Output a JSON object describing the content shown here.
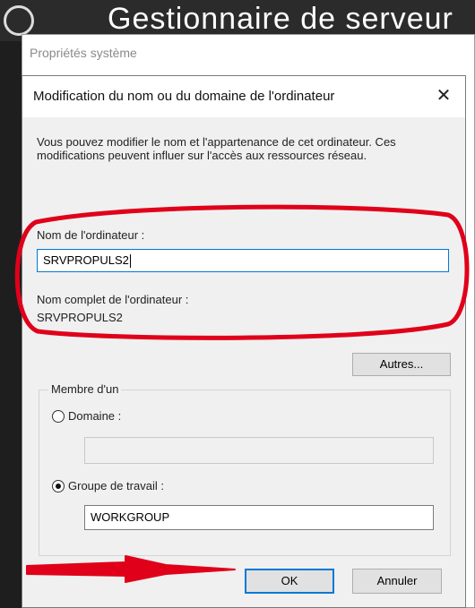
{
  "background_window": {
    "title": "Gestionnaire de serveur"
  },
  "system_properties": {
    "title": "Propriétés système"
  },
  "dialog": {
    "title": "Modification du nom ou du domaine de l'ordinateur",
    "close_symbol": "✕",
    "description": "Vous pouvez modifier le nom et l'appartenance de cet ordinateur. Ces modifications peuvent influer sur l'accès aux ressources réseau.",
    "computer_name_label": "Nom de l'ordinateur :",
    "computer_name_value": "SRVPROPULS2",
    "full_name_label": "Nom complet de l'ordinateur :",
    "full_name_value": "SRVPROPULS2",
    "more_button": "Autres...",
    "member_of": {
      "label": "Membre d'un",
      "domain_label": "Domaine :",
      "domain_value": "",
      "domain_selected": false,
      "workgroup_label": "Groupe de travail :",
      "workgroup_value": "WORKGROUP",
      "workgroup_selected": true
    },
    "ok_button": "OK",
    "cancel_button": "Annuler"
  },
  "annotation_color": "#e0001a",
  "accent_color": "#0078d7"
}
